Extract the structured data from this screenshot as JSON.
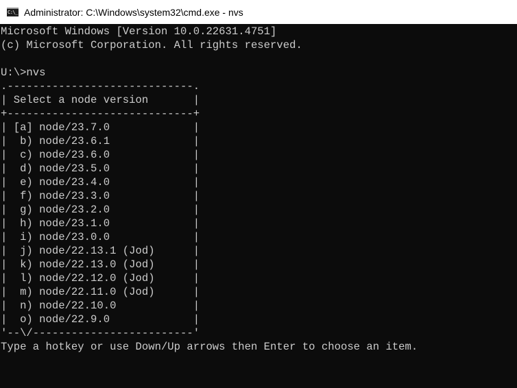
{
  "window": {
    "title": "Administrator: C:\\Windows\\system32\\cmd.exe - nvs",
    "icon_label": "C:\\_",
    "icon": "cmd-icon",
    "colors": {
      "background": "#0c0c0c",
      "foreground": "#cccccc",
      "titlebar": "#ffffff"
    }
  },
  "console": {
    "lines": [
      "Microsoft Windows [Version 10.0.22631.4751]",
      "(c) Microsoft Corporation. All rights reserved.",
      "",
      "U:\\>nvs",
      ".-----------------------------.",
      "| Select a node version       |",
      "+-----------------------------+",
      "| [a] node/23.7.0             |",
      "|  b) node/23.6.1             |",
      "|  c) node/23.6.0             |",
      "|  d) node/23.5.0             |",
      "|  e) node/23.4.0             |",
      "|  f) node/23.3.0             |",
      "|  g) node/23.2.0             |",
      "|  h) node/23.1.0             |",
      "|  i) node/23.0.0             |",
      "|  j) node/22.13.1 (Jod)      |",
      "|  k) node/22.13.0 (Jod)      |",
      "|  l) node/22.12.0 (Jod)      |",
      "|  m) node/22.11.0 (Jod)      |",
      "|  n) node/22.10.0            |",
      "|  o) node/22.9.0             |",
      "'--\\/-------------------------'",
      "Type a hotkey or use Down/Up arrows then Enter to choose an item."
    ]
  }
}
